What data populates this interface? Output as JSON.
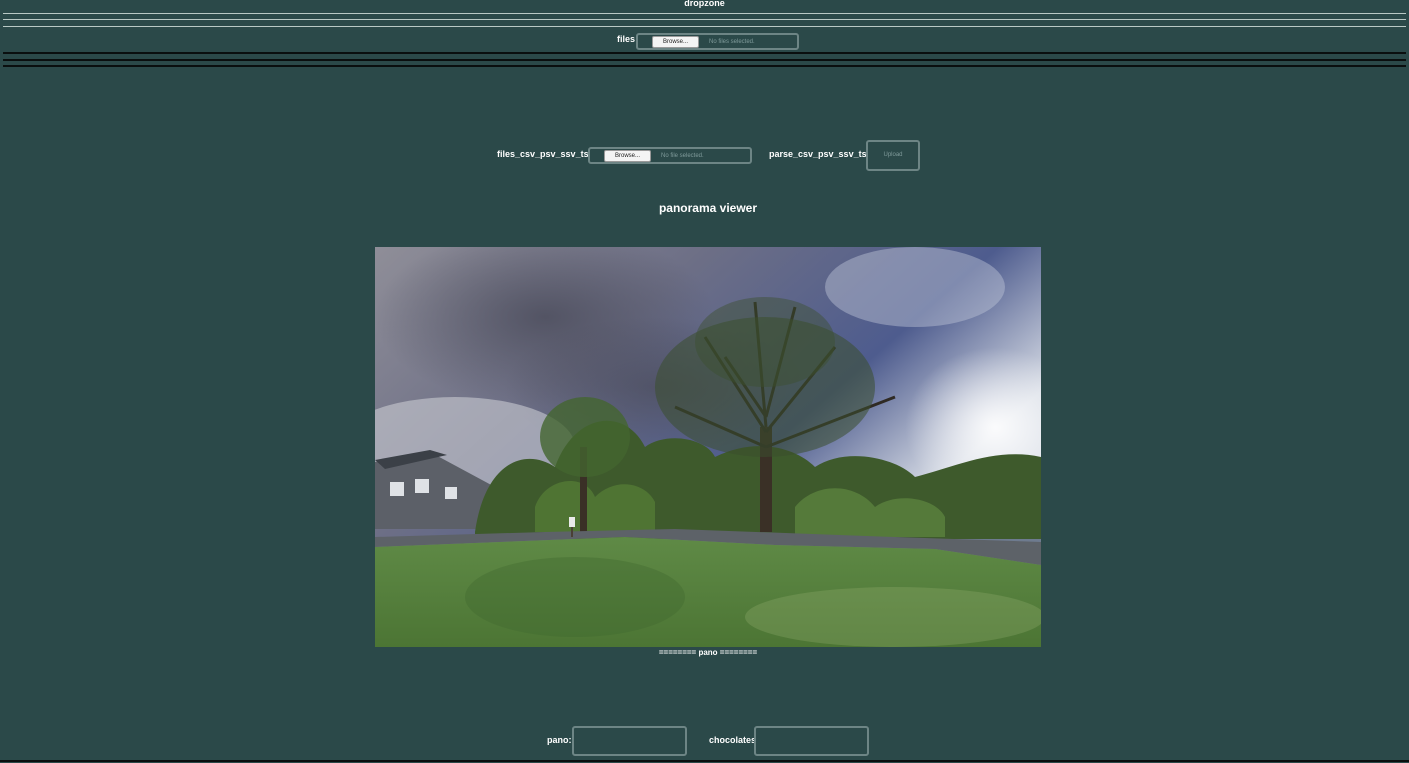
{
  "dropzone": {
    "title": "dropzone",
    "files_label": "files",
    "browse_label": "Browse...",
    "status": "No files selected."
  },
  "data_upload": {
    "files_label": "files_csv_psv_ssv_tsv",
    "browse_label": "Browse...",
    "status": "No file selected.",
    "parse_label": "parse_csv_psv_ssv_tsv",
    "upload_label": "Upload"
  },
  "viewer": {
    "title": "panorama viewer",
    "caption": "======== pano ========"
  },
  "form": {
    "pano_label": "pano:",
    "pano_value": "",
    "chocolates_label": "chocolates",
    "chocolates_value": ""
  },
  "colors": {
    "background": "#2b4949",
    "border": "#6d8585",
    "text": "#ffffff"
  }
}
